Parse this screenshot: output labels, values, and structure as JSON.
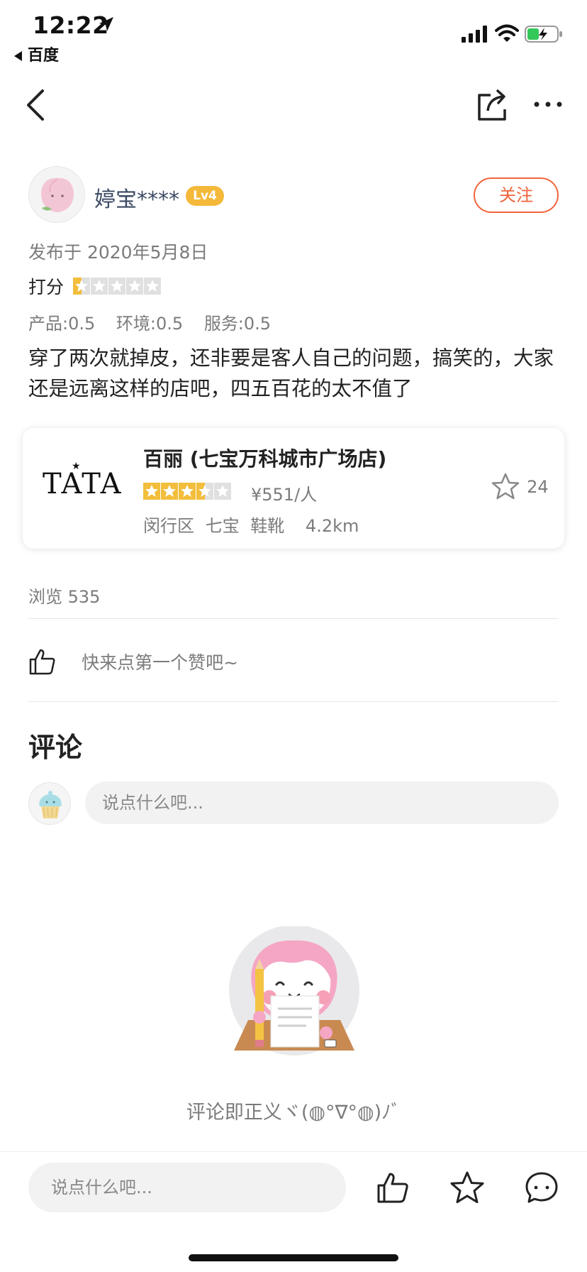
{
  "status_bar": {
    "time": "12:22",
    "back_app": "百度"
  },
  "author": {
    "name": "婷宝****",
    "level": "Lv4",
    "follow_label": "关注"
  },
  "review": {
    "published": "发布于 2020年5月8日",
    "score_label": "打分",
    "rating_fraction": 0.1,
    "subscores": [
      "产品:0.5",
      "环境:0.5",
      "服务:0.5"
    ],
    "text": "穿了两次就掉皮，还非要是客人自己的问题，搞笑的，大家还是远离这样的店吧，四五百花的太不值了"
  },
  "shop": {
    "logo_text": "TATA",
    "name": "百丽 (七宝万科城市广场店)",
    "rating_fraction": 0.7,
    "price": "¥551/人",
    "district": "闵行区",
    "area": "七宝",
    "category": "鞋靴",
    "distance": "4.2km",
    "fav_count": "24"
  },
  "views": "浏览 535",
  "like_prompt": "快来点第一个赞吧~",
  "comments": {
    "title": "评论",
    "placeholder": "说点什么吧...",
    "empty_text": "评论即正义ヾ(◍°∇°◍)ﾉﾞ"
  },
  "bottom_bar": {
    "placeholder": "说点什么吧..."
  },
  "colors": {
    "accent": "#f0643c",
    "star": "#f2be3c",
    "badge": "#f4b93a",
    "author_name": "#3c4a63"
  }
}
